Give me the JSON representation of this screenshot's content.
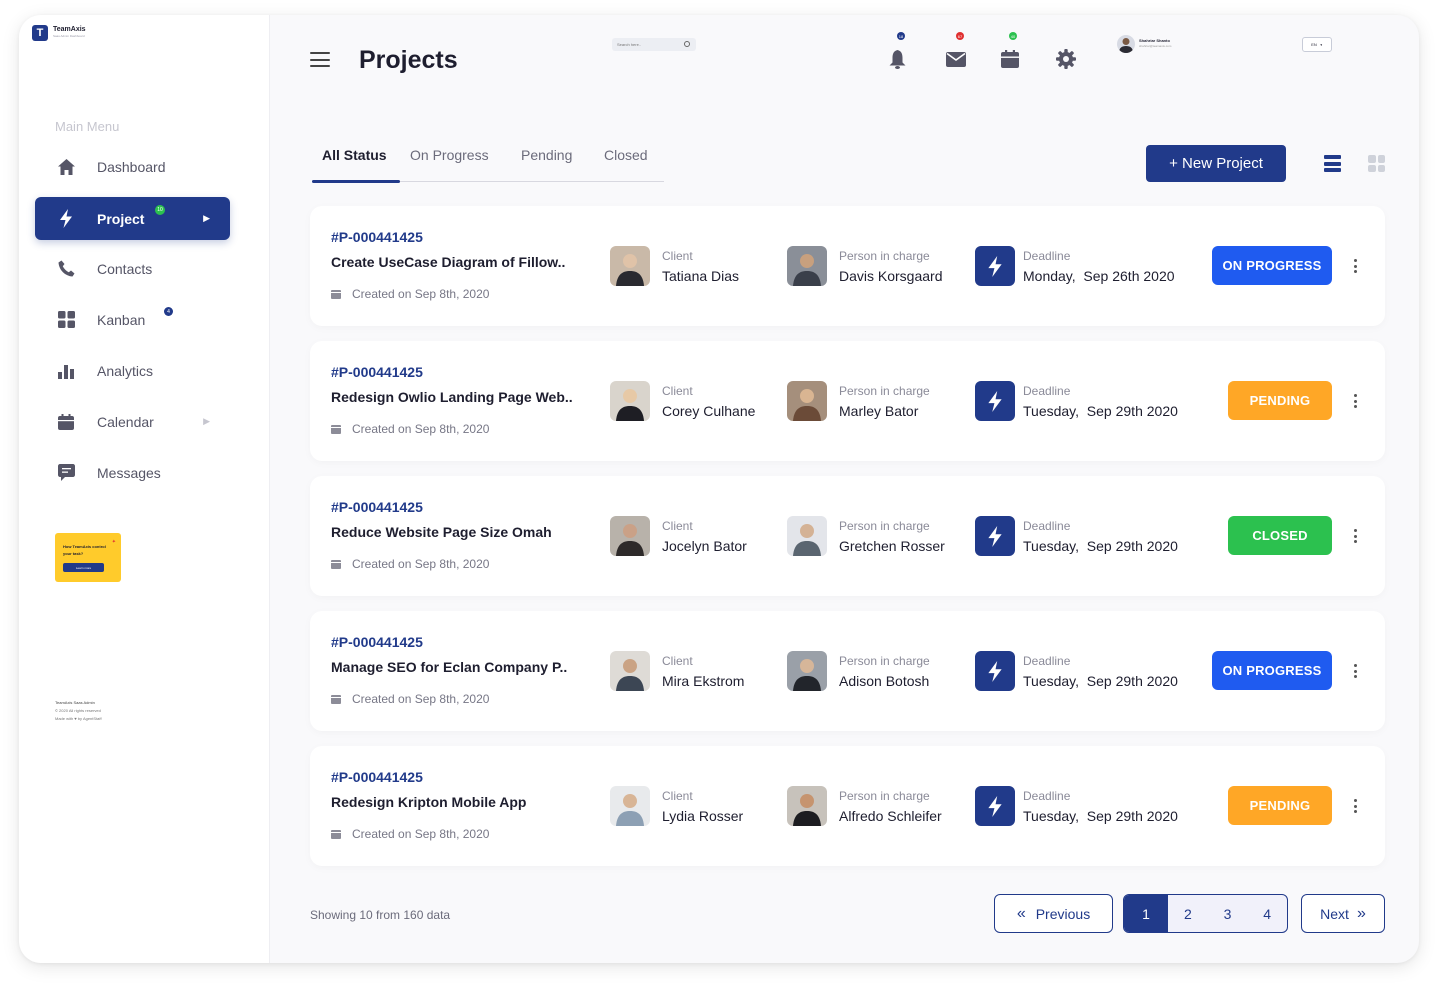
{
  "app": {
    "name": "TeamAxis",
    "subtitle": "Saas Admin Dashboard"
  },
  "sidebar": {
    "menu_title": "Main Menu",
    "items": [
      {
        "label": "Dashboard",
        "icon": "home-icon"
      },
      {
        "label": "Project",
        "icon": "lightning-icon",
        "badge": "10",
        "active": true
      },
      {
        "label": "Contacts",
        "icon": "phone-icon"
      },
      {
        "label": "Kanban",
        "icon": "grid-icon",
        "badge": "4"
      },
      {
        "label": "Analytics",
        "icon": "bar-chart-icon"
      },
      {
        "label": "Calendar",
        "icon": "calendar-icon"
      },
      {
        "label": "Messages",
        "icon": "chat-icon"
      }
    ],
    "promo": {
      "text": "How TeamAxis control your task?",
      "button": "Learn more"
    },
    "footer": {
      "name": "TeamAxis Saas Admin",
      "copyright": "© 2020 All rights reserved",
      "made_with": "Made with ♥ by AgentStaff"
    }
  },
  "header": {
    "title": "Projects",
    "search_placeholder": "Search here..",
    "notifications": {
      "badge": "18"
    },
    "mail": {
      "badge": "67"
    },
    "calendar": {
      "badge": "40"
    },
    "user": {
      "name": "Shahriar Shanto",
      "email": "shahriar@teamaxis.com"
    },
    "language": "EN"
  },
  "tabs": [
    {
      "label": "All Status",
      "active": true
    },
    {
      "label": "On Progress"
    },
    {
      "label": "Pending"
    },
    {
      "label": "Closed"
    }
  ],
  "new_project_label": "+ New Project",
  "labels": {
    "client": "Client",
    "person_in_charge": "Person in charge",
    "deadline": "Deadline"
  },
  "projects": [
    {
      "id": "#P-000441425",
      "title": "Create UseCase Diagram of Fillow..",
      "created": "Created on Sep 8th, 2020",
      "client": "Tatiana Dias",
      "person": "Davis Korsgaard",
      "deadline": "Monday,  Sep 26th 2020",
      "status": "ON PROGRESS"
    },
    {
      "id": "#P-000441425",
      "title": "Redesign Owlio Landing Page Web..",
      "created": "Created on Sep 8th, 2020",
      "client": "Corey Culhane",
      "person": "Marley Bator",
      "deadline": "Tuesday,  Sep 29th 2020",
      "status": "PENDING"
    },
    {
      "id": "#P-000441425",
      "title": "Reduce Website Page Size Omah",
      "created": "Created on Sep 8th, 2020",
      "client": "Jocelyn Bator",
      "person": "Gretchen Rosser",
      "deadline": "Tuesday,  Sep 29th 2020",
      "status": "CLOSED"
    },
    {
      "id": "#P-000441425",
      "title": "Manage SEO for Eclan Company P..",
      "created": "Created on Sep 8th, 2020",
      "client": "Mira Ekstrom",
      "person": "Adison Botosh",
      "deadline": "Tuesday,  Sep 29th 2020",
      "status": "ON PROGRESS"
    },
    {
      "id": "#P-000441425",
      "title": "Redesign Kripton Mobile App",
      "created": "Created on Sep 8th, 2020",
      "client": "Lydia Rosser",
      "person": "Alfredo Schleifer",
      "deadline": "Tuesday,  Sep 29th 2020",
      "status": "PENDING"
    }
  ],
  "status_colors": {
    "ON PROGRESS": "#1f5bf0",
    "PENDING": "#ffa726",
    "CLOSED": "#2cc14f"
  },
  "pagination": {
    "showing": "Showing 10 from 160 data",
    "previous": "Previous",
    "next": "Next",
    "pages": [
      "1",
      "2",
      "3",
      "4"
    ],
    "current": "1"
  }
}
